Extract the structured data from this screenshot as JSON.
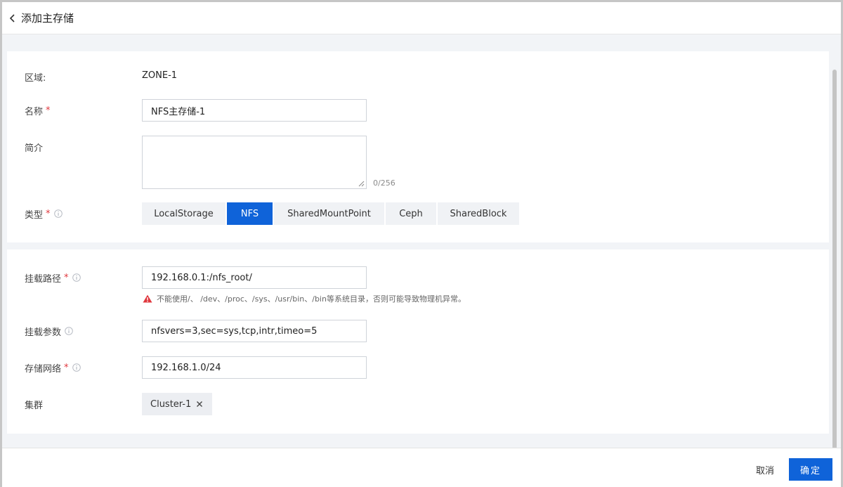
{
  "header": {
    "title": "添加主存储"
  },
  "section_basic": {
    "zone": {
      "label": "区域:",
      "value": "ZONE-1"
    },
    "name": {
      "label": "名称",
      "value": "NFS主存储-1"
    },
    "description": {
      "label": "简介",
      "value": "",
      "counter": "0/256"
    },
    "type": {
      "label": "类型",
      "options": [
        "LocalStorage",
        "NFS",
        "SharedMountPoint",
        "Ceph",
        "SharedBlock"
      ],
      "selected": "NFS"
    }
  },
  "section_mount": {
    "mount_path": {
      "label": "挂载路径",
      "value": "192.168.0.1:/nfs_root/",
      "warning": "不能使用/、 /dev、/proc、/sys、/usr/bin、/bin等系统目录，否则可能导致物理机异常。"
    },
    "mount_params": {
      "label": "挂载参数",
      "value": "nfsvers=3,sec=sys,tcp,intr,timeo=5"
    },
    "storage_network": {
      "label": "存储网络",
      "value": "192.168.1.0/24"
    },
    "cluster": {
      "label": "集群",
      "tag": "Cluster-1"
    }
  },
  "footer": {
    "cancel_label": "取消",
    "ok_label": "确定"
  },
  "colors": {
    "primary": "#0f63d9",
    "required": "#e0383e",
    "warning": "#e0383e"
  }
}
